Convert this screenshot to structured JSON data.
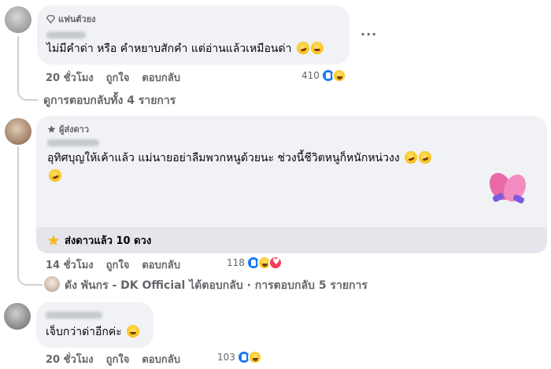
{
  "comments": [
    {
      "badge": "แฟนตัวยง",
      "text": "ไม่มีคำด่า หรือ คำหยาบสักคำ แต่อ่านแล้วเหมือนด่า",
      "time": "20 ชั่วโมง",
      "like": "ถูกใจ",
      "reply": "ตอบกลับ",
      "reaction_count": "410",
      "reactions": [
        "like-icon",
        "haha-icon"
      ],
      "more": "...",
      "view_replies": "ดูการตอบกลับทั้ง 4 รายการ"
    },
    {
      "badge": "ผู้ส่งดาว",
      "text_line1": "อุทิศบุญให้เค้าแล้ว แม่นายอย่าลืมพวกหนูด้วยนะ ช่วงนี้ชีวิตหนูก็หนักหน่วงง",
      "stars_text": "ส่งดาวแล้ว 10 ดวง",
      "time": "14 ชั่วโมง",
      "like": "ถูกใจ",
      "reply": "ตอบกลับ",
      "reaction_count": "118",
      "reactions": [
        "like-icon",
        "haha-icon",
        "love-icon"
      ],
      "reply_summary": "ดัง พันกร - DK Official ได้ตอบกลับ · การตอบกลับ 5 รายการ"
    },
    {
      "text": "เจ็บกว่าด่าอีกค่ะ",
      "time": "20 ชั่วโมง",
      "like": "ถูกใจ",
      "reply": "ตอบกลับ",
      "reaction_count": "103",
      "reactions": [
        "like-icon",
        "haha-icon"
      ]
    }
  ],
  "colors": {
    "bubble": "#f0f2f5",
    "meta_text": "#65676b",
    "like_blue": "#1877f2",
    "love_red": "#f33e58"
  }
}
